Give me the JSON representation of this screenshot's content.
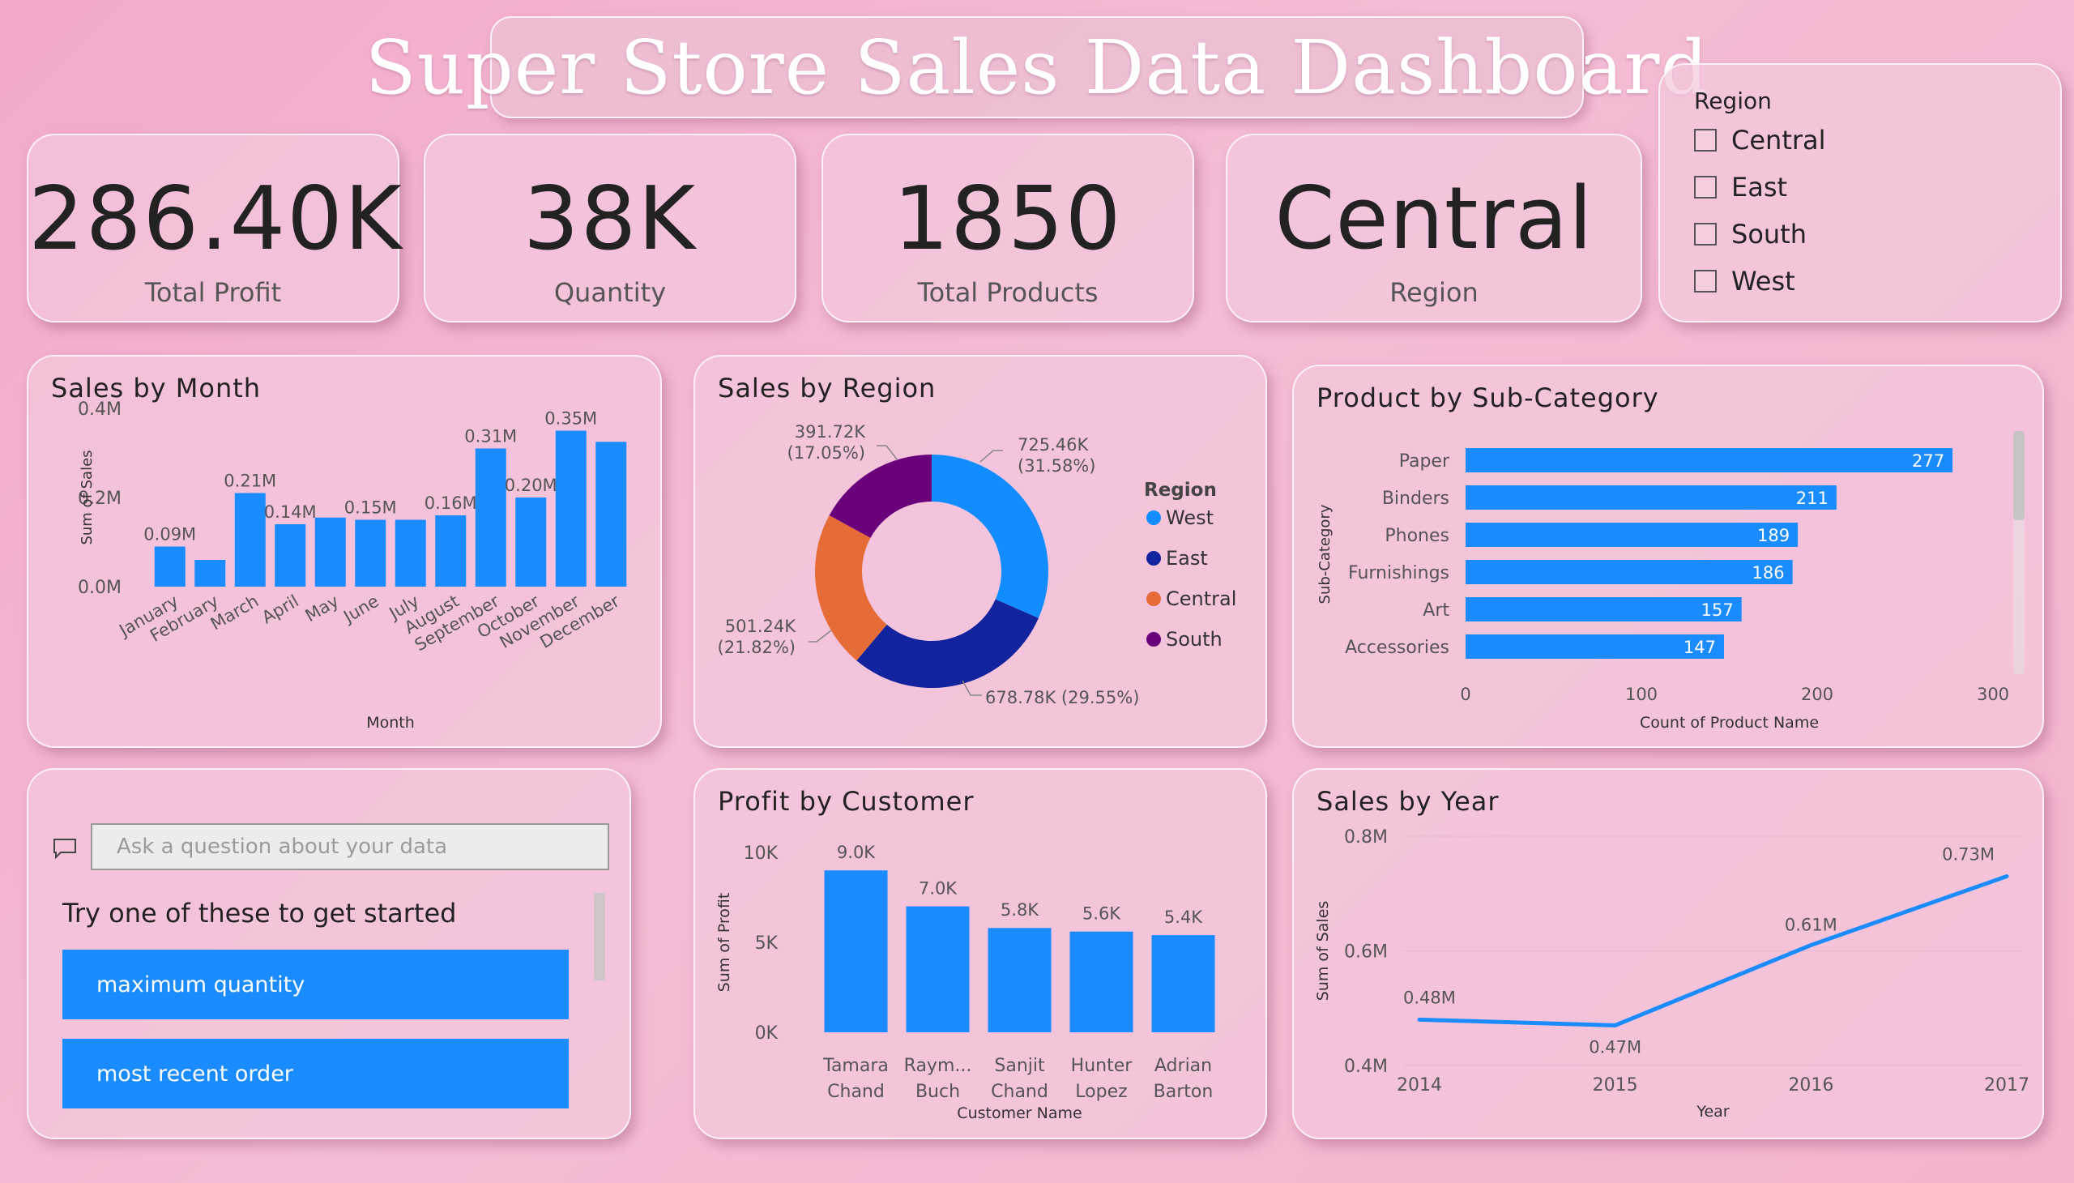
{
  "title": "Super Store Sales Data Dashboard",
  "kpis": {
    "profit": {
      "value": "286.40K",
      "label": "Total Profit"
    },
    "quantity": {
      "value": "38K",
      "label": "Quantity"
    },
    "products": {
      "value": "1850",
      "label": "Total Products"
    },
    "region": {
      "value": "Central",
      "label": "Region"
    }
  },
  "slicer": {
    "title": "Region",
    "items": [
      {
        "label": "Central",
        "checked": false
      },
      {
        "label": "East",
        "checked": false
      },
      {
        "label": "South",
        "checked": false
      },
      {
        "label": "West",
        "checked": false
      }
    ]
  },
  "qa": {
    "placeholder": "Ask a question about your data",
    "hint": "Try one of these to get started",
    "suggestions": [
      "maximum quantity",
      "most recent order"
    ]
  },
  "colors": {
    "bar": "#1a8cff",
    "west": "#118dff",
    "east": "#12239e",
    "central": "#e66c37",
    "south": "#6b007b"
  },
  "chart_data": [
    {
      "id": "sales-by-month",
      "type": "bar",
      "title": "Sales by Month",
      "xlabel": "Month",
      "ylabel": "Sum of Sales",
      "ylim": [
        0,
        0.4
      ],
      "yticks": [
        "0.0M",
        "0.2M",
        "0.4M"
      ],
      "categories": [
        "January",
        "February",
        "March",
        "April",
        "May",
        "June",
        "July",
        "August",
        "September",
        "October",
        "November",
        "December"
      ],
      "values": [
        0.09,
        0.06,
        0.21,
        0.14,
        0.155,
        0.15,
        0.15,
        0.16,
        0.31,
        0.2,
        0.35,
        0.325
      ],
      "data_labels": [
        "0.09M",
        "",
        "0.21M",
        "0.14M",
        "",
        "0.15M",
        "",
        "0.16M",
        "0.31M",
        "0.20M",
        "0.35M",
        ""
      ]
    },
    {
      "id": "sales-by-region",
      "type": "pie",
      "title": "Sales by Region",
      "legend_title": "Region",
      "legend_position": "right",
      "slices": [
        {
          "name": "West",
          "value": 725.46,
          "label": "725.46K",
          "pct": "(31.58%)"
        },
        {
          "name": "East",
          "value": 678.78,
          "label": "678.78K",
          "pct": "(29.55%)"
        },
        {
          "name": "Central",
          "value": 501.24,
          "label": "501.24K",
          "pct": "(21.82%)"
        },
        {
          "name": "South",
          "value": 391.72,
          "label": "391.72K",
          "pct": "(17.05%)"
        }
      ]
    },
    {
      "id": "product-by-subcategory",
      "type": "bar",
      "orientation": "horizontal",
      "title": "Product by Sub-Category",
      "xlabel": "Count of Product Name",
      "ylabel": "Sub-Category",
      "xlim": [
        0,
        300
      ],
      "xticks": [
        "0",
        "100",
        "200",
        "300"
      ],
      "categories": [
        "Paper",
        "Binders",
        "Phones",
        "Furnishings",
        "Art",
        "Accessories"
      ],
      "values": [
        277,
        211,
        189,
        186,
        157,
        147
      ]
    },
    {
      "id": "profit-by-customer",
      "type": "bar",
      "title": "Profit by Customer",
      "xlabel": "Customer Name",
      "ylabel": "Sum of Profit",
      "ylim": [
        0,
        10
      ],
      "yticks": [
        "0K",
        "5K",
        "10K"
      ],
      "categories": [
        [
          "Tamara",
          "Chand"
        ],
        [
          "Raym...",
          "Buch"
        ],
        [
          "Sanjit",
          "Chand"
        ],
        [
          "Hunter",
          "Lopez"
        ],
        [
          "Adrian",
          "Barton"
        ]
      ],
      "values": [
        9.0,
        7.0,
        5.8,
        5.6,
        5.4
      ],
      "data_labels": [
        "9.0K",
        "7.0K",
        "5.8K",
        "5.6K",
        "5.4K"
      ]
    },
    {
      "id": "sales-by-year",
      "type": "line",
      "title": "Sales by Year",
      "xlabel": "Year",
      "ylabel": "Sum of Sales",
      "ylim": [
        0.4,
        0.8
      ],
      "yticks": [
        "0.4M",
        "0.6M",
        "0.8M"
      ],
      "x": [
        "2014",
        "2015",
        "2016",
        "2017"
      ],
      "values": [
        0.48,
        0.47,
        0.61,
        0.73
      ],
      "data_labels": [
        "0.48M",
        "0.47M",
        "0.61M",
        "0.73M"
      ]
    }
  ]
}
